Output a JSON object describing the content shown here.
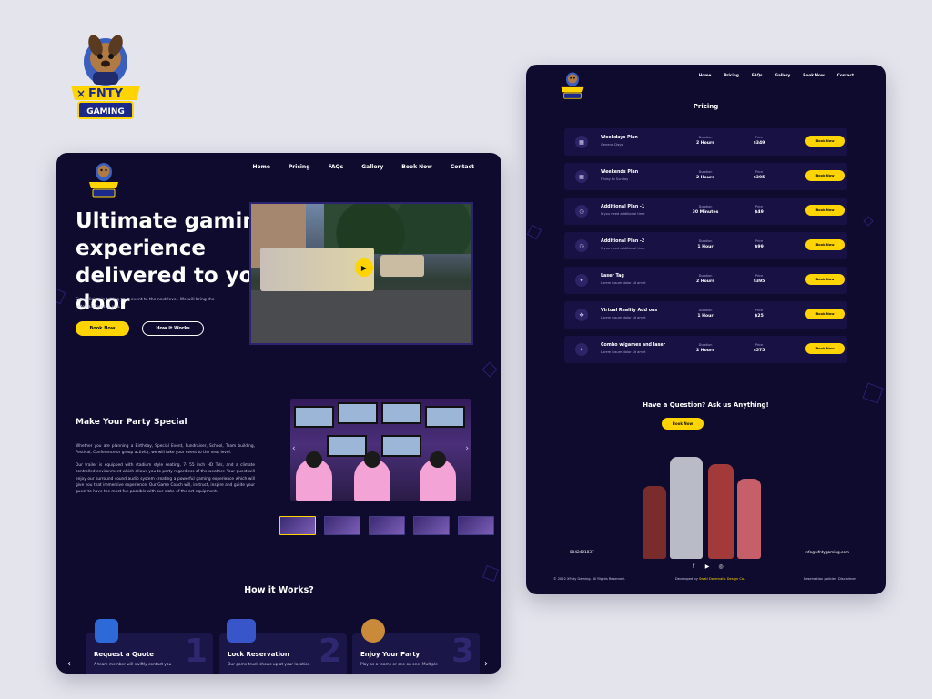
{
  "brand": {
    "name": "FNTY",
    "subtitle": "GAMING"
  },
  "colors": {
    "background": "#e4e5ec",
    "card": "#0f0b2e",
    "accent": "#ffd400",
    "panel": "#181244"
  },
  "left": {
    "nav": [
      "Home",
      "Pricing",
      "FAQs",
      "Gallery",
      "Book Now",
      "Contact"
    ],
    "hero": {
      "title": "Ultimate gaming experience delivered to your door",
      "subtitle": "Specializing in taking your event to the next level. We will bring the entertainment to you.",
      "primary_button": "Book Now",
      "secondary_button": "How it Works"
    },
    "party": {
      "title": "Make Your Party Special",
      "paragraph1": "Whether you are planning a Birthday, Special Event, Fundraiser, School, Team building, Festival, Conference or group activity, we will take your event to the next level.",
      "paragraph2": "Our trailer is equipped with stadium style seating, 7- 55 inch HD TVs, and a climate controlled environment which allows you to party regardless of the weather. Your guest will enjoy our surround sound audio system creating a powerful gaming experience which will give you that immersive experience. Our Game Coach will, instruct, inspire and guide your guest to have the most fun possible with our state-of-the art equipment."
    },
    "how_it_works": {
      "title": "How it Works?",
      "steps": [
        {
          "number": "1",
          "title": "Request a Quote",
          "text": "A team member will swiftly contact you"
        },
        {
          "number": "2",
          "title": "Lock Reservation",
          "text": "Our game truck shows up at your location"
        },
        {
          "number": "3",
          "title": "Enjoy Your Party",
          "text": "Play as a teams or one on one. Multiple"
        }
      ]
    }
  },
  "right": {
    "nav": [
      "Home",
      "Pricing",
      "FAQs",
      "Gallery",
      "Book Now",
      "Contact"
    ],
    "pricing_title": "Pricing",
    "duration_label": "Duration",
    "price_label": "Price",
    "book_label": "Book Now",
    "plans": [
      {
        "icon": "calendar-icon",
        "name": "Weekdays Plan",
        "desc": "General Days",
        "duration": "2 Hours",
        "price": "$349"
      },
      {
        "icon": "calendar-icon",
        "name": "Weekends Plan",
        "desc": "Friday to Sunday",
        "duration": "2 Hours",
        "price": "$395"
      },
      {
        "icon": "clock-icon",
        "name": "Additional Plan -1",
        "desc": "If you need additional time",
        "duration": "30 Minutes",
        "price": "$49"
      },
      {
        "icon": "clock-icon",
        "name": "Additional Plan -2",
        "desc": "If you need additional time",
        "duration": "1 Hour",
        "price": "$99"
      },
      {
        "icon": "bulb-icon",
        "name": "Laser Tag",
        "desc": "Lorem ipsum dolor sit amet",
        "duration": "2 Hours",
        "price": "$395"
      },
      {
        "icon": "vr-icon",
        "name": "Virtual Reality Add ons",
        "desc": "Lorem ipsum dolor sit amet",
        "duration": "1 Hour",
        "price": "$25"
      },
      {
        "icon": "bulb-icon",
        "name": "Combo w/games and laser",
        "desc": "Lorem ipsum dolor sit amet",
        "duration": "2 Hours",
        "price": "$575"
      }
    ],
    "question": {
      "title": "Have a Question? Ask us Anything!",
      "button": "Book Now"
    },
    "footer": {
      "phone": "8042401837",
      "email": "info@xfntygaming.com",
      "copyright": "© 2022 XFnty Gaming. All Rights Reserved.",
      "developed_prefix": "Developed by",
      "developer": "Swati Datematic Design Co.",
      "links": [
        "Reservation policies",
        "Disclaimer"
      ]
    }
  }
}
